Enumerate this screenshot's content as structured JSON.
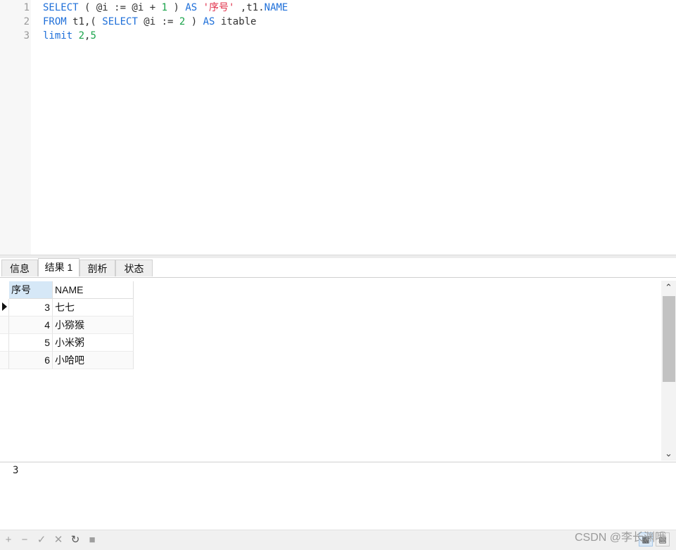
{
  "editor": {
    "line_numbers": [
      "1",
      "2",
      "3"
    ],
    "lines": [
      [
        {
          "t": "SELECT",
          "k": "kw"
        },
        {
          "t": " ( @i := @i + ",
          "k": "txt"
        },
        {
          "t": "1",
          "k": "num"
        },
        {
          "t": " ) ",
          "k": "txt"
        },
        {
          "t": "AS",
          "k": "kw"
        },
        {
          "t": " ",
          "k": "txt"
        },
        {
          "t": "'序号'",
          "k": "str"
        },
        {
          "t": " ,t1.",
          "k": "txt"
        },
        {
          "t": "NAME",
          "k": "kw"
        }
      ],
      [
        {
          "t": "FROM",
          "k": "kw"
        },
        {
          "t": " t1,( ",
          "k": "txt"
        },
        {
          "t": "SELECT",
          "k": "kw"
        },
        {
          "t": " @i := ",
          "k": "txt"
        },
        {
          "t": "2",
          "k": "num"
        },
        {
          "t": " ) ",
          "k": "txt"
        },
        {
          "t": "AS",
          "k": "kw"
        },
        {
          "t": " itable",
          "k": "txt"
        }
      ],
      [
        {
          "t": "limit",
          "k": "kw"
        },
        {
          "t": " ",
          "k": "txt"
        },
        {
          "t": "2",
          "k": "num"
        },
        {
          "t": ",",
          "k": "txt"
        },
        {
          "t": "5",
          "k": "num"
        }
      ]
    ]
  },
  "tabs": [
    {
      "label": "信息",
      "active": false
    },
    {
      "label": "结果 1",
      "active": true
    },
    {
      "label": "剖析",
      "active": false
    },
    {
      "label": "状态",
      "active": false
    }
  ],
  "grid": {
    "columns": [
      "序号",
      "NAME"
    ],
    "rows": [
      {
        "seq": "3",
        "name": "七七"
      },
      {
        "seq": "4",
        "name": "小猕猴"
      },
      {
        "seq": "5",
        "name": "小米粥"
      },
      {
        "seq": "6",
        "name": "小哈吧"
      }
    ],
    "current_row_marker": "▶"
  },
  "value_panel": {
    "text": "3"
  },
  "toolbar": {
    "buttons": [
      {
        "icon": "plus-icon",
        "glyph": "+"
      },
      {
        "icon": "minus-icon",
        "glyph": "−"
      },
      {
        "icon": "check-icon",
        "glyph": "✓"
      },
      {
        "icon": "x-icon",
        "glyph": "✕"
      },
      {
        "icon": "refresh-icon",
        "glyph": "↻"
      },
      {
        "icon": "stop-icon",
        "glyph": "■"
      }
    ],
    "watermark": "CSDN @李长渊哦"
  },
  "colors": {
    "keyword": "#1e6fd9",
    "number": "#19a34a",
    "string": "#e0304a",
    "header_highlight": "#d6e8f7"
  }
}
